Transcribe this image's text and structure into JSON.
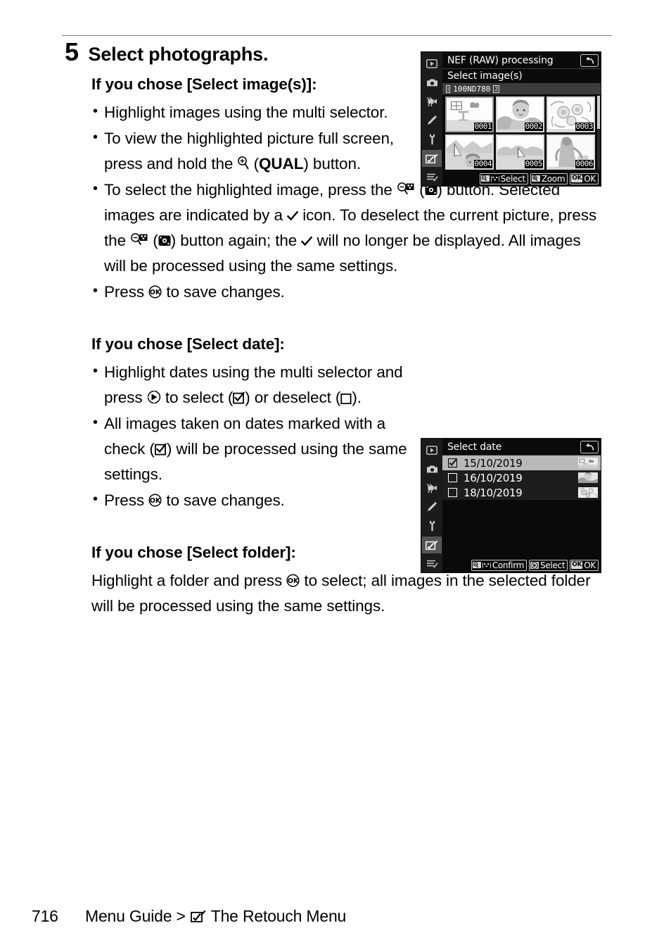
{
  "page": {
    "number": "716",
    "footer_prefix": "Menu Guide >",
    "footer_icon": "retouch-menu-icon",
    "footer_section": "The Retouch Menu"
  },
  "step": {
    "number": "5",
    "title": "Select photographs."
  },
  "sections": [
    {
      "heading_prefix": "If you chose [",
      "heading_item": "Select image(s)",
      "heading_suffix": "]:",
      "bullets": [
        "Highlight images using the multi selector.",
        "To view the highlighted picture full screen, press and hold the ⊕ (QUAL) button.",
        "To select the highlighted image, press the ⊖ (◉) button. Selected images are indicated by a ✔ icon. To deselect the current picture, press the ⊖ (◉) button again; the ✔ will no longer be displayed. All images will be processed using the same settings.",
        "Press ⒪ to save changes."
      ]
    },
    {
      "heading_prefix": "If you chose [",
      "heading_item": "Select date",
      "heading_suffix": "]:",
      "bullets": [
        "Highlight dates using the multi selector and press ▶ to select (☑) or deselect (☐).",
        "All images taken on dates marked with a check (☑) will be processed using the same settings.",
        "Press ⒪ to save changes."
      ]
    },
    {
      "heading_prefix": "If you chose [",
      "heading_item": "Select folder",
      "heading_suffix": "]:",
      "paragraph": "Highlight a folder and press ⒪ to select; all images in the selected folder will be processed using the same settings."
    }
  ],
  "text_fragments": {
    "b1_line": "Highlight images using the multi selector.",
    "b2_a": "To view the highlighted picture full screen, press and hold the ",
    "b2_qual": "QUAL",
    "b2_b": ") button.",
    "b3_a": "To select the highlighted image, press the ",
    "b3_b": ") button. Selected images are indicated by a ",
    "b3_c": " icon. To deselect the current picture, press the ",
    "b3_d": ") button again; the ",
    "b3_e": " will no longer be displayed. All images will be processed using the same settings.",
    "b4_a": "Press ",
    "b4_b": " to save changes.",
    "d1_a": "Highlight dates using the multi selector and press ",
    "d1_b": " to select (",
    "d1_c": ") or deselect (",
    "d1_d": ").",
    "d2_a": "All images taken on dates marked with a check (",
    "d2_b": ") will be processed using the same settings.",
    "f1_a": "Highlight a folder and press ",
    "f1_b": " to select; all images in the selected folder will be processed using the same settings."
  },
  "screen_image_select": {
    "title": "NEF (RAW) processing",
    "subtitle": "Select image(s)",
    "folder_label": "100ND780",
    "folder_info_icon": "i",
    "folder_slot_icon": "2",
    "back_icon": "back-arrow-icon",
    "rail_icons": [
      "playback-menu-icon",
      "photo-shooting-menu-icon",
      "movie-shooting-menu-icon",
      "custom-settings-menu-icon",
      "setup-menu-icon",
      "retouch-menu-icon",
      "my-menu-icon"
    ],
    "rail_selected_index": 5,
    "thumbnails": [
      {
        "number": "0001",
        "selected": true
      },
      {
        "number": "0002",
        "selected": false
      },
      {
        "number": "0003",
        "selected": false
      },
      {
        "number": "0004",
        "selected": false
      },
      {
        "number": "0005",
        "selected": false
      },
      {
        "number": "0006",
        "selected": false
      }
    ],
    "footer_buttons": [
      {
        "key": "zoom-out-grid",
        "label": "Select"
      },
      {
        "key": "zoom-in",
        "label": "Zoom"
      },
      {
        "key": "OK",
        "label": "OK"
      }
    ]
  },
  "screen_date_select": {
    "title": "Select date",
    "back_icon": "back-arrow-icon",
    "rail_icons": [
      "playback-menu-icon",
      "photo-shooting-menu-icon",
      "movie-shooting-menu-icon",
      "custom-settings-menu-icon",
      "setup-menu-icon",
      "retouch-menu-icon",
      "my-menu-icon"
    ],
    "rail_selected_index": 5,
    "rows": [
      {
        "date": "15/10/2019",
        "checked": true,
        "active": true
      },
      {
        "date": "16/10/2019",
        "checked": false,
        "active": false
      },
      {
        "date": "18/10/2019",
        "checked": false,
        "active": false
      }
    ],
    "footer_buttons": [
      {
        "key": "zoom-out-grid",
        "label": "Confirm"
      },
      {
        "key": "multi-selector",
        "label": "Select"
      },
      {
        "key": "OK",
        "label": "OK"
      }
    ]
  },
  "colors": {
    "page_bg": "#ffffff",
    "text": "#000000",
    "rule": "#7a7a7a",
    "screen_bg": "#0a0a0a",
    "screen_rail": "#1b1b1b",
    "screen_rail_selected": "#555555",
    "row_active": "#b9b9b9",
    "row_idle": "#1d1d1d",
    "folderbar": "#3c3c3c"
  }
}
